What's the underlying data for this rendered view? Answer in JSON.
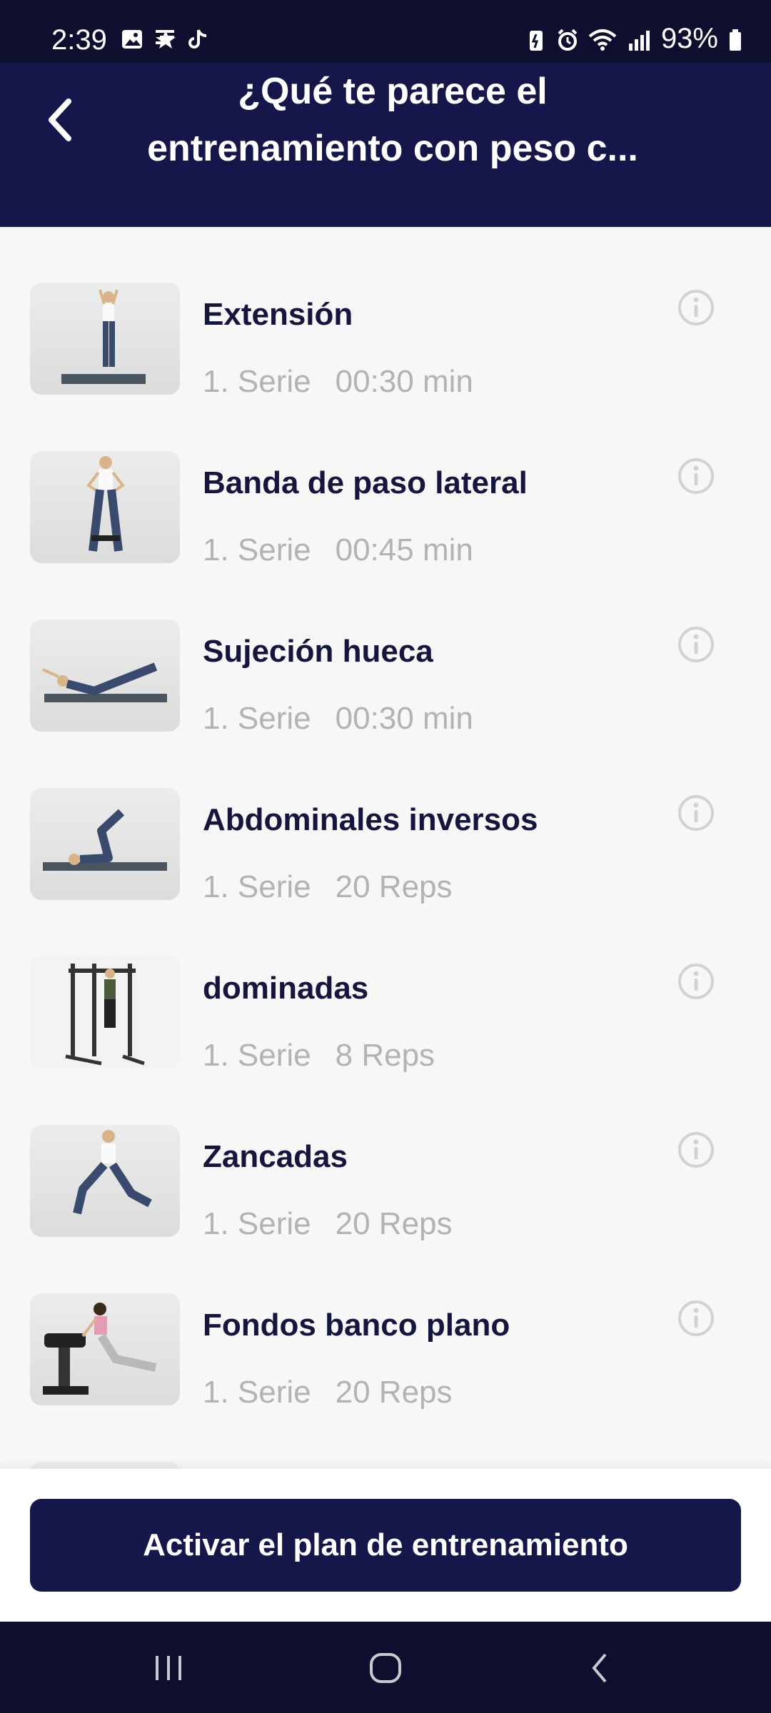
{
  "status_bar": {
    "time": "2:39",
    "battery": "93%"
  },
  "header": {
    "title": "¿Qué te parece el entrenamiento con peso c..."
  },
  "exercises": [
    {
      "name": "Extensión",
      "sets": "1. Serie",
      "amount": "00:30 min"
    },
    {
      "name": "Banda de paso lateral",
      "sets": "1. Serie",
      "amount": "00:45 min"
    },
    {
      "name": "Sujeción hueca",
      "sets": "1. Serie",
      "amount": "00:30 min"
    },
    {
      "name": "Abdominales inversos",
      "sets": "1. Serie",
      "amount": "20 Reps"
    },
    {
      "name": "dominadas",
      "sets": "1. Serie",
      "amount": "8 Reps"
    },
    {
      "name": "Zancadas",
      "sets": "1. Serie",
      "amount": "20 Reps"
    },
    {
      "name": "Fondos banco plano",
      "sets": "1. Serie",
      "amount": "20 Reps"
    }
  ],
  "cta": {
    "label": "Activar el plan de entrenamiento"
  },
  "colors": {
    "header_bg": "#15174a",
    "status_bg": "#0e0f2e",
    "text_primary": "#14163d",
    "text_secondary": "#b2b2b7"
  }
}
